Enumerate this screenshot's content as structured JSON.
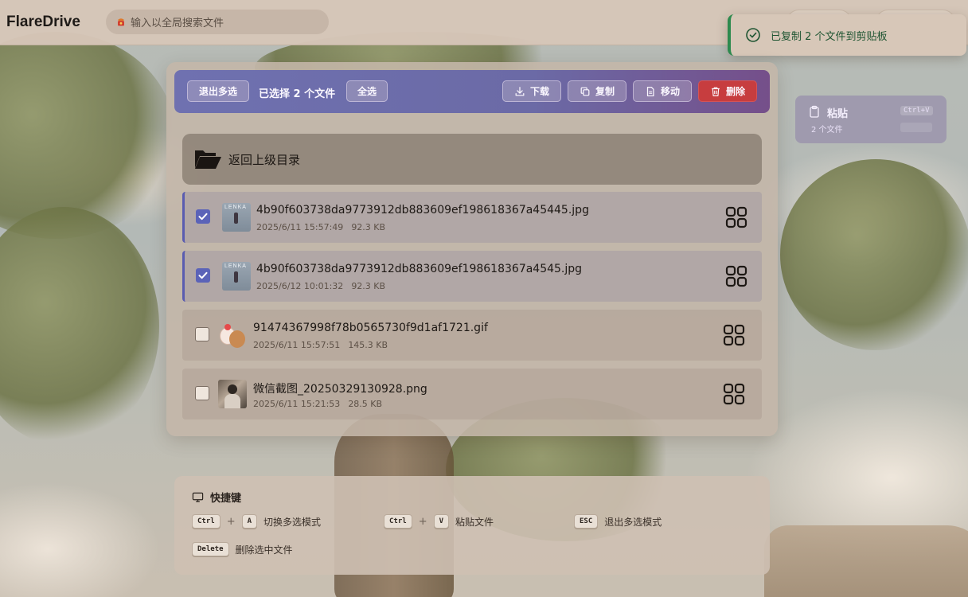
{
  "app": {
    "title": "FlareDrive",
    "search_placeholder": "输入以全局搜索文件"
  },
  "toast": {
    "message": "已复制 2 个文件到剪贴板",
    "status": "success",
    "color": "#2d8a4e"
  },
  "paste_panel": {
    "label": "粘贴",
    "shortcut": "Ctrl+V",
    "count": "2 个文件"
  },
  "toolbar": {
    "exit_multiselect_label": "退出多选",
    "selected_count_text": "已选择 2 个文件",
    "select_all_label": "全选",
    "download_label": "下载",
    "copy_label": "复制",
    "move_label": "移动",
    "delete_label": "删除",
    "accent_color": "#6f71b0",
    "delete_color": "#c73d3f"
  },
  "back_row": {
    "label": "返回上级目录"
  },
  "files": [
    {
      "name": "4b90f603738da9773912db883609ef198618367a45445.jpg",
      "date": "2025/6/11 15:57:49",
      "size": "92.3 KB",
      "selected": true,
      "thumb_text": "LENKA"
    },
    {
      "name": "4b90f603738da9773912db883609ef198618367a4545.jpg",
      "date": "2025/6/12 10:01:32",
      "size": "92.3 KB",
      "selected": true,
      "thumb_text": "LENKA"
    },
    {
      "name": "91474367998f78b0565730f9d1af1721.gif",
      "date": "2025/6/11 15:57:51",
      "size": "145.3 KB",
      "selected": false
    },
    {
      "name": "微信截图_20250329130928.png",
      "date": "2025/6/11 15:21:53",
      "size": "28.5 KB",
      "selected": false
    }
  ],
  "shortcuts": {
    "title": "快捷键",
    "items": [
      {
        "keys": [
          "Ctrl",
          "A"
        ],
        "label": "切换多选模式"
      },
      {
        "keys": [
          "Ctrl",
          "V"
        ],
        "label": "粘贴文件"
      },
      {
        "keys": [
          "ESC"
        ],
        "label": "退出多选模式"
      },
      {
        "keys": [
          "Delete"
        ],
        "label": "删除选中文件"
      }
    ],
    "plus": "+"
  },
  "icons": {
    "search": "search-icon",
    "toast": "check-circle-icon",
    "clipboard": "clipboard-icon",
    "download": "download-icon",
    "copy": "copy-icon",
    "move": "file-icon",
    "delete": "trash-icon",
    "folder": "folder-open-icon",
    "file_action": "grid-icon",
    "keyboard": "monitor-icon"
  }
}
